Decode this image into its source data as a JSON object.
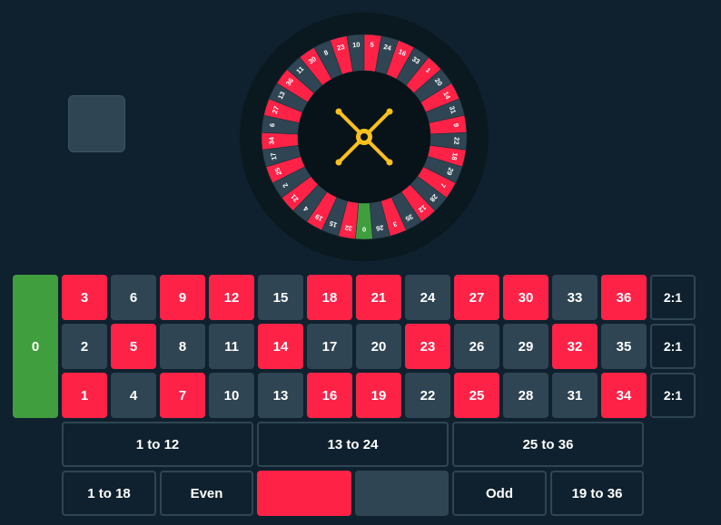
{
  "wheel": {
    "pockets": [
      "0",
      "32",
      "15",
      "19",
      "4",
      "21",
      "2",
      "25",
      "17",
      "34",
      "6",
      "27",
      "13",
      "36",
      "11",
      "30",
      "8",
      "23",
      "10",
      "5",
      "24",
      "16",
      "33",
      "1",
      "20",
      "14",
      "31",
      "9",
      "22",
      "18",
      "29",
      "7",
      "28",
      "12",
      "35",
      "3",
      "26"
    ],
    "red_numbers": [
      "1",
      "3",
      "5",
      "7",
      "9",
      "12",
      "14",
      "16",
      "18",
      "19",
      "21",
      "23",
      "25",
      "27",
      "30",
      "32",
      "34",
      "36"
    ],
    "colors": {
      "red": "#fe2247",
      "black": "#2f4553",
      "green": "#419e3f",
      "rim": "#0a1920",
      "hub": "#071319",
      "turret": "#fec01a"
    }
  },
  "board": {
    "zero": "0",
    "rows": [
      [
        "3",
        "6",
        "9",
        "12",
        "15",
        "18",
        "21",
        "24",
        "27",
        "30",
        "33",
        "36"
      ],
      [
        "2",
        "5",
        "8",
        "11",
        "14",
        "17",
        "20",
        "23",
        "26",
        "29",
        "32",
        "35"
      ],
      [
        "1",
        "4",
        "7",
        "10",
        "13",
        "16",
        "19",
        "22",
        "25",
        "28",
        "31",
        "34"
      ]
    ],
    "column_bets": [
      "2:1",
      "2:1",
      "2:1"
    ],
    "dozens": [
      "1 to 12",
      "13 to 24",
      "25 to 36"
    ],
    "even_money": {
      "low": "1 to 18",
      "even": "Even",
      "red": "",
      "black": "",
      "odd": "Odd",
      "high": "19 to 36"
    }
  }
}
